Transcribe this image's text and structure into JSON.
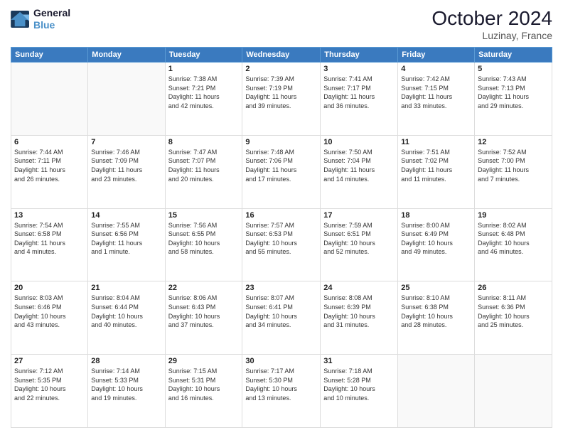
{
  "header": {
    "logo": {
      "line1": "General",
      "line2": "Blue"
    },
    "title": "October 2024",
    "location": "Luzinay, France"
  },
  "calendar": {
    "days_of_week": [
      "Sunday",
      "Monday",
      "Tuesday",
      "Wednesday",
      "Thursday",
      "Friday",
      "Saturday"
    ],
    "weeks": [
      [
        {
          "day": "",
          "info": ""
        },
        {
          "day": "",
          "info": ""
        },
        {
          "day": "1",
          "info": "Sunrise: 7:38 AM\nSunset: 7:21 PM\nDaylight: 11 hours\nand 42 minutes."
        },
        {
          "day": "2",
          "info": "Sunrise: 7:39 AM\nSunset: 7:19 PM\nDaylight: 11 hours\nand 39 minutes."
        },
        {
          "day": "3",
          "info": "Sunrise: 7:41 AM\nSunset: 7:17 PM\nDaylight: 11 hours\nand 36 minutes."
        },
        {
          "day": "4",
          "info": "Sunrise: 7:42 AM\nSunset: 7:15 PM\nDaylight: 11 hours\nand 33 minutes."
        },
        {
          "day": "5",
          "info": "Sunrise: 7:43 AM\nSunset: 7:13 PM\nDaylight: 11 hours\nand 29 minutes."
        }
      ],
      [
        {
          "day": "6",
          "info": "Sunrise: 7:44 AM\nSunset: 7:11 PM\nDaylight: 11 hours\nand 26 minutes."
        },
        {
          "day": "7",
          "info": "Sunrise: 7:46 AM\nSunset: 7:09 PM\nDaylight: 11 hours\nand 23 minutes."
        },
        {
          "day": "8",
          "info": "Sunrise: 7:47 AM\nSunset: 7:07 PM\nDaylight: 11 hours\nand 20 minutes."
        },
        {
          "day": "9",
          "info": "Sunrise: 7:48 AM\nSunset: 7:06 PM\nDaylight: 11 hours\nand 17 minutes."
        },
        {
          "day": "10",
          "info": "Sunrise: 7:50 AM\nSunset: 7:04 PM\nDaylight: 11 hours\nand 14 minutes."
        },
        {
          "day": "11",
          "info": "Sunrise: 7:51 AM\nSunset: 7:02 PM\nDaylight: 11 hours\nand 11 minutes."
        },
        {
          "day": "12",
          "info": "Sunrise: 7:52 AM\nSunset: 7:00 PM\nDaylight: 11 hours\nand 7 minutes."
        }
      ],
      [
        {
          "day": "13",
          "info": "Sunrise: 7:54 AM\nSunset: 6:58 PM\nDaylight: 11 hours\nand 4 minutes."
        },
        {
          "day": "14",
          "info": "Sunrise: 7:55 AM\nSunset: 6:56 PM\nDaylight: 11 hours\nand 1 minute."
        },
        {
          "day": "15",
          "info": "Sunrise: 7:56 AM\nSunset: 6:55 PM\nDaylight: 10 hours\nand 58 minutes."
        },
        {
          "day": "16",
          "info": "Sunrise: 7:57 AM\nSunset: 6:53 PM\nDaylight: 10 hours\nand 55 minutes."
        },
        {
          "day": "17",
          "info": "Sunrise: 7:59 AM\nSunset: 6:51 PM\nDaylight: 10 hours\nand 52 minutes."
        },
        {
          "day": "18",
          "info": "Sunrise: 8:00 AM\nSunset: 6:49 PM\nDaylight: 10 hours\nand 49 minutes."
        },
        {
          "day": "19",
          "info": "Sunrise: 8:02 AM\nSunset: 6:48 PM\nDaylight: 10 hours\nand 46 minutes."
        }
      ],
      [
        {
          "day": "20",
          "info": "Sunrise: 8:03 AM\nSunset: 6:46 PM\nDaylight: 10 hours\nand 43 minutes."
        },
        {
          "day": "21",
          "info": "Sunrise: 8:04 AM\nSunset: 6:44 PM\nDaylight: 10 hours\nand 40 minutes."
        },
        {
          "day": "22",
          "info": "Sunrise: 8:06 AM\nSunset: 6:43 PM\nDaylight: 10 hours\nand 37 minutes."
        },
        {
          "day": "23",
          "info": "Sunrise: 8:07 AM\nSunset: 6:41 PM\nDaylight: 10 hours\nand 34 minutes."
        },
        {
          "day": "24",
          "info": "Sunrise: 8:08 AM\nSunset: 6:39 PM\nDaylight: 10 hours\nand 31 minutes."
        },
        {
          "day": "25",
          "info": "Sunrise: 8:10 AM\nSunset: 6:38 PM\nDaylight: 10 hours\nand 28 minutes."
        },
        {
          "day": "26",
          "info": "Sunrise: 8:11 AM\nSunset: 6:36 PM\nDaylight: 10 hours\nand 25 minutes."
        }
      ],
      [
        {
          "day": "27",
          "info": "Sunrise: 7:12 AM\nSunset: 5:35 PM\nDaylight: 10 hours\nand 22 minutes."
        },
        {
          "day": "28",
          "info": "Sunrise: 7:14 AM\nSunset: 5:33 PM\nDaylight: 10 hours\nand 19 minutes."
        },
        {
          "day": "29",
          "info": "Sunrise: 7:15 AM\nSunset: 5:31 PM\nDaylight: 10 hours\nand 16 minutes."
        },
        {
          "day": "30",
          "info": "Sunrise: 7:17 AM\nSunset: 5:30 PM\nDaylight: 10 hours\nand 13 minutes."
        },
        {
          "day": "31",
          "info": "Sunrise: 7:18 AM\nSunset: 5:28 PM\nDaylight: 10 hours\nand 10 minutes."
        },
        {
          "day": "",
          "info": ""
        },
        {
          "day": "",
          "info": ""
        }
      ]
    ]
  }
}
